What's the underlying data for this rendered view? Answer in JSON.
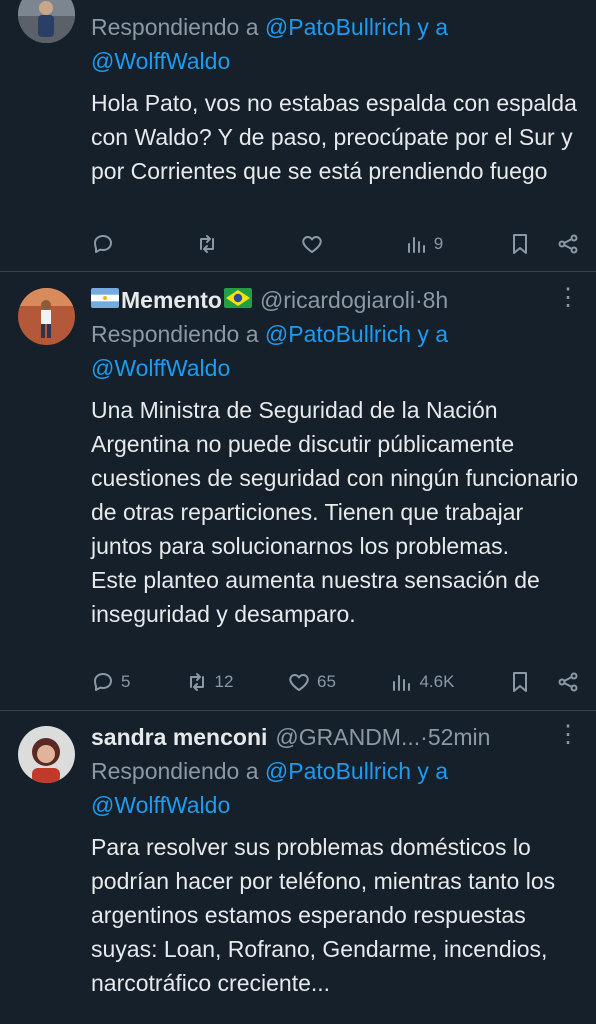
{
  "tweets": [
    {
      "name": "",
      "reply_prefix": "Respondiendo a ",
      "mention1": "@PatoBullrich",
      "reply_and": " y a",
      "mention2": "@WolffWaldo",
      "text": "Hola Pato, vos no estabas espalda con espalda con Waldo? Y de paso, preocúpate por el Sur y por Corrientes que se está prendiendo fuego",
      "replies": "",
      "retweets": "",
      "likes": "",
      "views": "9"
    },
    {
      "name": "Memento",
      "handle": "@ricardogiaroli",
      "dot": " · ",
      "time": "8h",
      "reply_prefix": "Respondiendo a ",
      "mention1": "@PatoBullrich",
      "reply_and": " y a",
      "mention2": "@WolffWaldo",
      "text": "Una Ministra de Seguridad de la Nación Argentina no puede discutir públicamente cuestiones de seguridad con ningún funcionario  de otras reparticiones. Tienen que trabajar juntos para solucionarnos los problemas.\nEste planteo aumenta nuestra sensación de inseguridad y desamparo.",
      "replies": "5",
      "retweets": "12",
      "likes": "65",
      "views": "4.6K"
    },
    {
      "name": "sandra menconi",
      "handle": "@GRANDM...",
      "dot": " · ",
      "time": "52min",
      "reply_prefix": "Respondiendo a ",
      "mention1": "@PatoBullrich",
      "reply_and": " y a",
      "mention2": "@WolffWaldo",
      "text": "Para resolver sus problemas domésticos lo podrían hacer por teléfono, mientras tanto los argentinos estamos esperando respuestas suyas: Loan, Rofrano, Gendarme, incendios, narcotráfico creciente..."
    }
  ],
  "colors": {
    "background": "#15202b",
    "text": "#e7e9ea",
    "muted": "#8b98a5",
    "link": "#1d9bf0",
    "divider": "#38444d"
  }
}
